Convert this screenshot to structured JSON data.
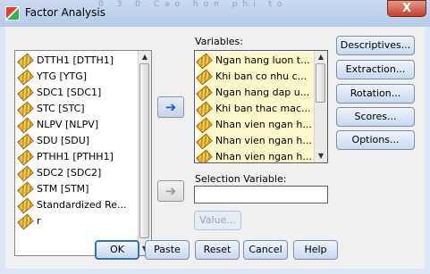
{
  "window": {
    "title": "Factor Analysis",
    "background_ghost_text": "0        3        0        Cao hon phi to",
    "close_label": "X"
  },
  "source_list": {
    "items": [
      "DTTH1 [DTTH1]",
      "YTG [YTG]",
      "SDC1 [SDC1]",
      "STC [STC]",
      "NLPV [NLPV]",
      "SDU [SDU]",
      "PTHH1 [PTHH1]",
      "SDC2 [SDC2]",
      "STM [STM]",
      "Standardized Re...",
      "r"
    ]
  },
  "variables": {
    "label": "Variables:",
    "items": [
      "Ngan hang luon t...",
      "Khi ban co nhu c...",
      "Ngan hang dap u...",
      "Khi ban thac mac...",
      "Nhan vien ngan h...",
      "Nhan vien ngan h...",
      "Nhan vien ngan h..."
    ]
  },
  "selection": {
    "label": "Selection Variable:",
    "value": "",
    "value_button": "Value..."
  },
  "move_buttons": {
    "move_in": "➜",
    "move_out": "➜"
  },
  "side_buttons": [
    "Descriptives...",
    "Extraction...",
    "Rotation...",
    "Scores...",
    "Options..."
  ],
  "bottom_buttons": [
    "OK",
    "Paste",
    "Reset",
    "Cancel",
    "Help"
  ]
}
